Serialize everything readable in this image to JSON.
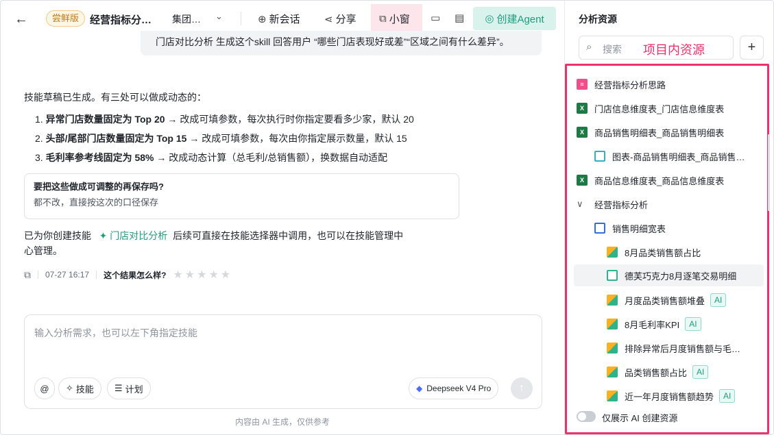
{
  "header": {
    "badge": "尝鲜版",
    "title": "经营指标分…",
    "group": "集团…",
    "new_chat": "新会话",
    "share": "分享",
    "mini_window": "小窗",
    "create_agent": "创建Agent"
  },
  "chat": {
    "user_message": "门店对比分析 生成这个skill 回答用户 “哪些门店表现好或差”“区域之间有什么差异”。",
    "intro": "技能草稿已生成。有三处可以做成动态的：",
    "items": [
      {
        "num": "1.",
        "bold": "异常门店数量固定为 Top 20",
        "rest": " → 改成可填参数，每次执行时你指定要看多少家，默认 20"
      },
      {
        "num": "2.",
        "bold": "头部/尾部门店数量固定为 Top 15",
        "rest": " → 改成可填参数，每次由你指定展示数量，默认 15"
      },
      {
        "num": "3.",
        "bold": "毛利率参考线固定为 58%",
        "rest": " → 改成动态计算（总毛利/总销售额），换数据自动适配"
      }
    ],
    "question_title": "要把这些做成可调整的再保存吗?",
    "question_answer": "都不改，直接按这次的口径保存",
    "created_prefix": "已为你创建技能",
    "skill_name": "门店对比分析",
    "created_suffix": "后续可直接在技能选择器中调用，也可以在技能管理中",
    "created_suffix2": "心管理。",
    "timestamp": "07-27 16:17",
    "feedback_label": "这个结果怎么样?",
    "rating": 0,
    "rating_max": 5
  },
  "input": {
    "placeholder": "输入分析需求，也可以左下角指定技能",
    "at": "@",
    "skill": "技能",
    "plan": "计划",
    "model": "Deepseek V4 Pro"
  },
  "footer": "内容由 AI 生成，仅供参考",
  "sidebar": {
    "title": "分析资源",
    "search_placeholder": "搜索",
    "annotation": "项目内资源",
    "add": "+",
    "items": [
      {
        "label": "经营指标分析思路",
        "icon": "doc-icon",
        "ai": ""
      },
      {
        "label": "门店信息维度表_门店信息维度表",
        "icon": "excel-icon",
        "ai": ""
      },
      {
        "label": "商品销售明细表_商品销售明细表",
        "icon": "excel-icon",
        "ai": ""
      },
      {
        "label": "图表-商品销售明细表_商品销售…",
        "icon": "table-chart-icon",
        "ai": ""
      },
      {
        "label": "商品信息维度表_商品信息维度表",
        "icon": "excel-icon",
        "ai": ""
      },
      {
        "label": "经营指标分析",
        "icon": "chevron-down-icon",
        "ai": ""
      },
      {
        "label": "销售明细宽表",
        "icon": "dataset-icon",
        "ai": ""
      },
      {
        "label": "8月品类销售额占比",
        "icon": "dashboard-icon",
        "ai": ""
      },
      {
        "label": "德芙巧克力8月逐笔交易明细",
        "icon": "table-icon",
        "ai": ""
      },
      {
        "label": "月度品类销售额堆叠",
        "icon": "dashboard-icon",
        "ai": "AI"
      },
      {
        "label": "8月毛利率KPI",
        "icon": "dashboard-icon",
        "ai": "AI"
      },
      {
        "label": "排除异常后月度销售额与毛…",
        "icon": "dashboard-icon",
        "ai": ""
      },
      {
        "label": "品类销售额占比",
        "icon": "dashboard-icon",
        "ai": "AI"
      },
      {
        "label": "近一年月度销售额趋势",
        "icon": "dashboard-icon",
        "ai": "AI"
      }
    ],
    "toggle_label": "仅展示 AI 创建资源"
  }
}
